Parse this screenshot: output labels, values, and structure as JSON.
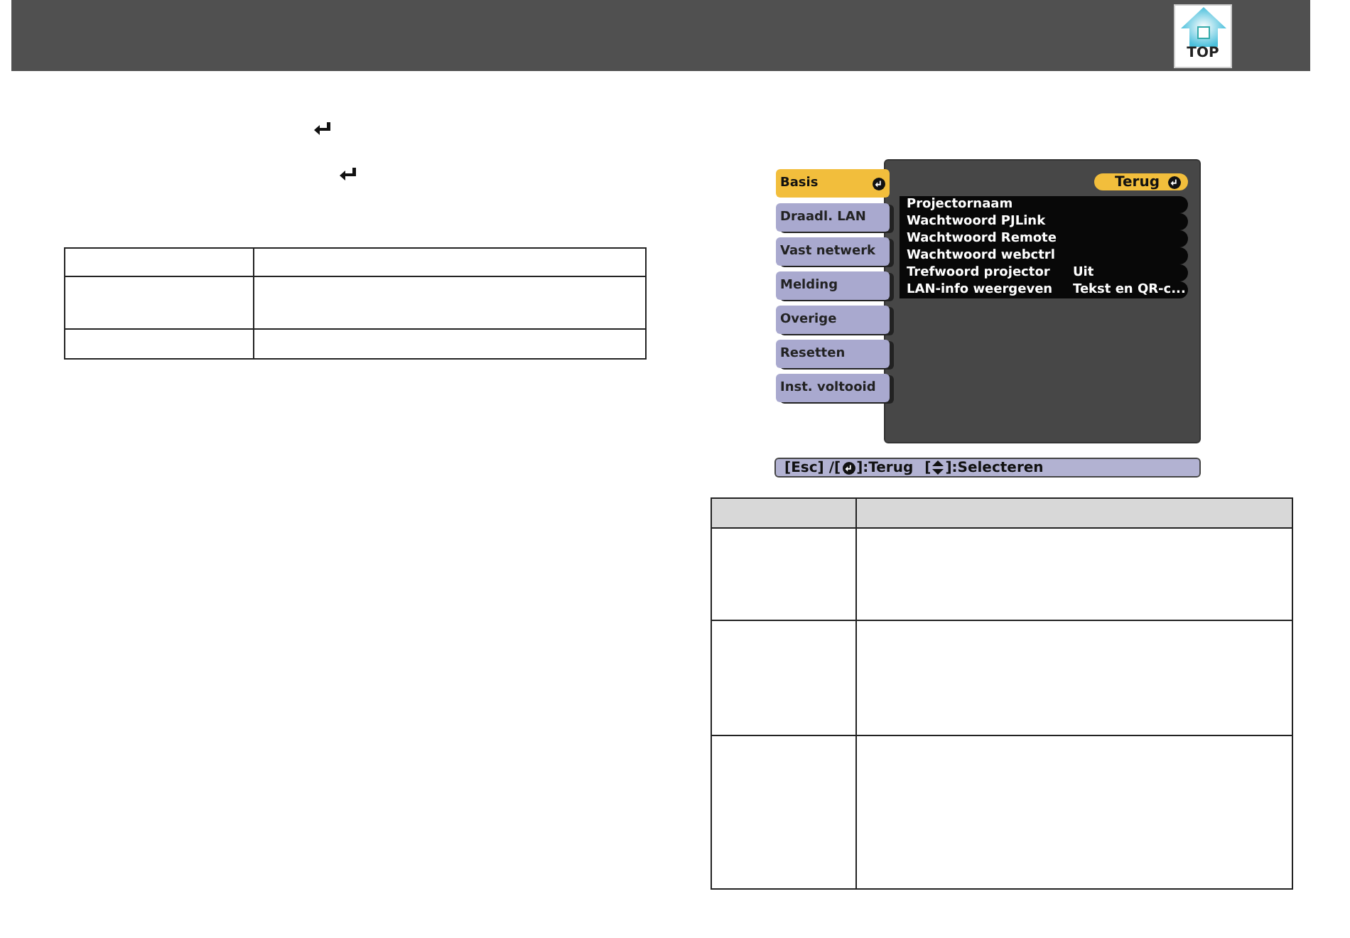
{
  "header": {
    "top_label": "TOP"
  },
  "menu": {
    "tabs": [
      {
        "label": "Basis",
        "selected": true
      },
      {
        "label": "Draadl. LAN",
        "selected": false
      },
      {
        "label": "Vast netwerk",
        "selected": false
      },
      {
        "label": "Melding",
        "selected": false
      },
      {
        "label": "Overige",
        "selected": false
      },
      {
        "label": "Resetten",
        "selected": false
      },
      {
        "label": "Inst. voltooid",
        "selected": false
      }
    ],
    "back_button": "Terug",
    "items": [
      {
        "label": "Projectornaam"
      },
      {
        "label": "Wachtwoord PJLink"
      },
      {
        "label": "Wachtwoord Remote"
      },
      {
        "label": "Wachtwoord webctrl"
      },
      {
        "label": "Trefwoord projector",
        "value": "Uit"
      },
      {
        "label": "LAN-info weergeven",
        "value": "Tekst en QR-c..."
      }
    ],
    "status_bar": {
      "back_prefix": "[Esc] /[",
      "back_suffix": "]:Terug",
      "select_prefix": "[",
      "select_suffix": "]:Selecteren"
    }
  }
}
